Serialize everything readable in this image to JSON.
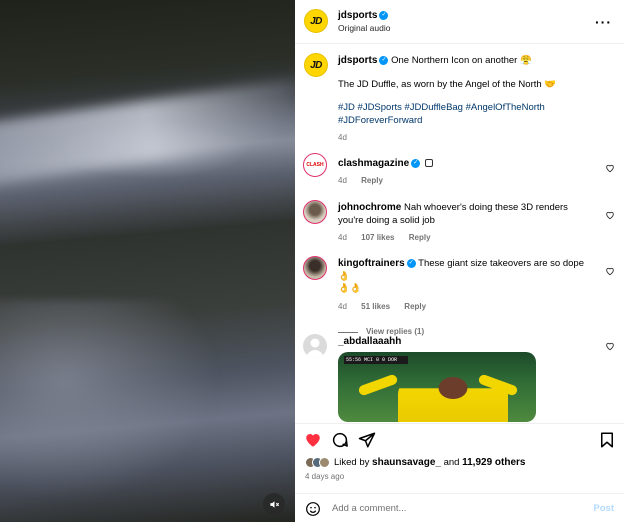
{
  "header": {
    "username": "jdsports",
    "subtitle": "Original audio"
  },
  "avatar_text": "JD",
  "caption": {
    "username": "jdsports",
    "line1": "One Northern Icon on another 😤",
    "line2": "The JD Duffle, as worn by the Angel of the North 🤝",
    "hashtags_line1": "#JD #JDSports #JDDuffleBag #AngelOfTheNorth",
    "hashtags_line2": "#JDForeverForward",
    "time": "4d"
  },
  "comments": [
    {
      "username": "clashmagazine",
      "avatar_text": "CLASH",
      "text": "",
      "time": "4d",
      "likes": "",
      "reply": "Reply"
    },
    {
      "username": "johnochrome",
      "text": "Nah whoever's doing these 3D renders you're doing a solid job",
      "time": "4d",
      "likes": "107 likes",
      "reply": "Reply"
    },
    {
      "username": "kingoftrainers",
      "text": "These giant size takeovers are so dope 👌",
      "text2": "👌👌",
      "time": "4d",
      "likes": "51 likes",
      "reply": "Reply"
    },
    {
      "username": "_abdallaaahh",
      "text": "",
      "gif_score": "55:56  MCI  0  0  DOR"
    }
  ],
  "view_replies": "View replies (1)",
  "likes": {
    "prefix": "Liked by ",
    "user": "shaunsavage_",
    "suffix": " and ",
    "count": "11,929 others"
  },
  "posted_ago": "4 days ago",
  "comment_input": {
    "placeholder": "Add a comment...",
    "post_label": "Post"
  },
  "colors": {
    "like_red": "#ff3040",
    "verified_blue": "#0095f6",
    "jd_yellow": "#ffd600"
  }
}
